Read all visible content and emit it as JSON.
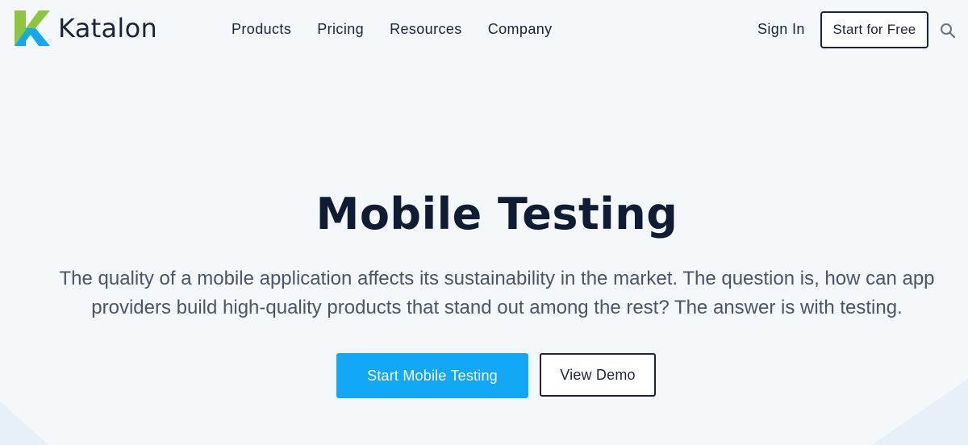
{
  "brand": {
    "name": "Katalon",
    "colors": {
      "logo_green": "#8cc63f",
      "logo_teal": "#1fb6b0",
      "logo_blue": "#13a8f5"
    }
  },
  "nav": {
    "items": [
      {
        "label": "Products"
      },
      {
        "label": "Pricing"
      },
      {
        "label": "Resources"
      },
      {
        "label": "Company"
      }
    ],
    "sign_in_label": "Sign In",
    "start_free_label": "Start for Free",
    "search_icon": "search-icon"
  },
  "hero": {
    "title": "Mobile Testing",
    "description": "The quality of a mobile application affects its sustainability in the market. The question is, how can app providers build high-quality products that stand out among the rest? The answer is with testing.",
    "primary_button_label": "Start Mobile Testing",
    "secondary_button_label": "View Demo",
    "colors": {
      "primary_button": "#13a8f5",
      "background": "#f4f8fb",
      "title": "#0f1c33"
    }
  }
}
